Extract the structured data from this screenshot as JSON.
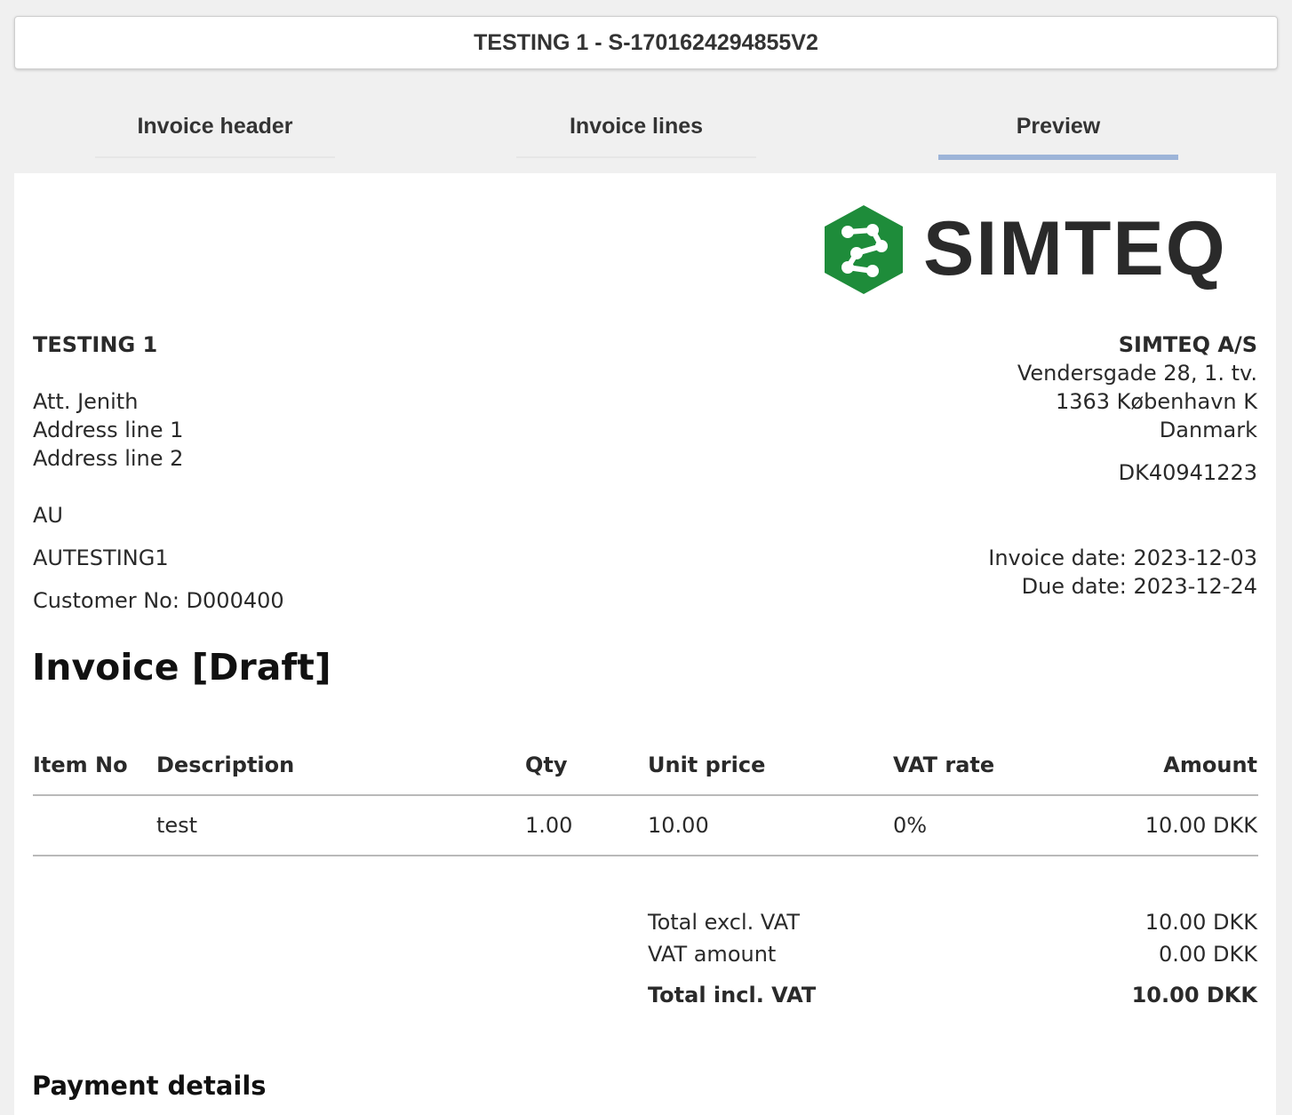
{
  "window": {
    "title": "TESTING 1 - S-1701624294855V2"
  },
  "tabs": [
    {
      "label": "Invoice header",
      "active": false
    },
    {
      "label": "Invoice lines",
      "active": false
    },
    {
      "label": "Preview",
      "active": true
    }
  ],
  "brand": {
    "name": "SIMTEQ",
    "logo_icon": "hexagon-molecule-icon",
    "green": "#1e8c3a",
    "accent": "#9db4d8"
  },
  "customer": {
    "name": "TESTING 1",
    "att": "Att. Jenith",
    "address1": "Address line 1",
    "address2": "Address line 2",
    "country": "AU",
    "vat_id": "AUTESTING1",
    "customer_no": "Customer No: D000400"
  },
  "seller": {
    "name": "SIMTEQ A/S",
    "street": "Vendersgade 28, 1. tv.",
    "city": "1363 København K",
    "country": "Danmark",
    "vat_id": "DK40941223"
  },
  "dates": {
    "invoice_date": "Invoice date: 2023-12-03",
    "due_date": "Due date: 2023-12-24"
  },
  "invoice_title": "Invoice [Draft]",
  "table": {
    "headers": [
      "Item No",
      "Description",
      "Qty",
      "Unit price",
      "VAT rate",
      "Amount"
    ],
    "rows": [
      {
        "item_no": "",
        "description": "test",
        "qty": "1.00",
        "unit_price": "10.00",
        "vat_rate": "0%",
        "amount": "10.00 DKK"
      }
    ]
  },
  "totals": {
    "excl_label": "Total excl. VAT",
    "excl_value": "10.00 DKK",
    "vat_label": "VAT amount",
    "vat_value": "0.00 DKK",
    "incl_label": "Total incl. VAT",
    "incl_value": "10.00 DKK"
  },
  "payment_title": "Payment details"
}
